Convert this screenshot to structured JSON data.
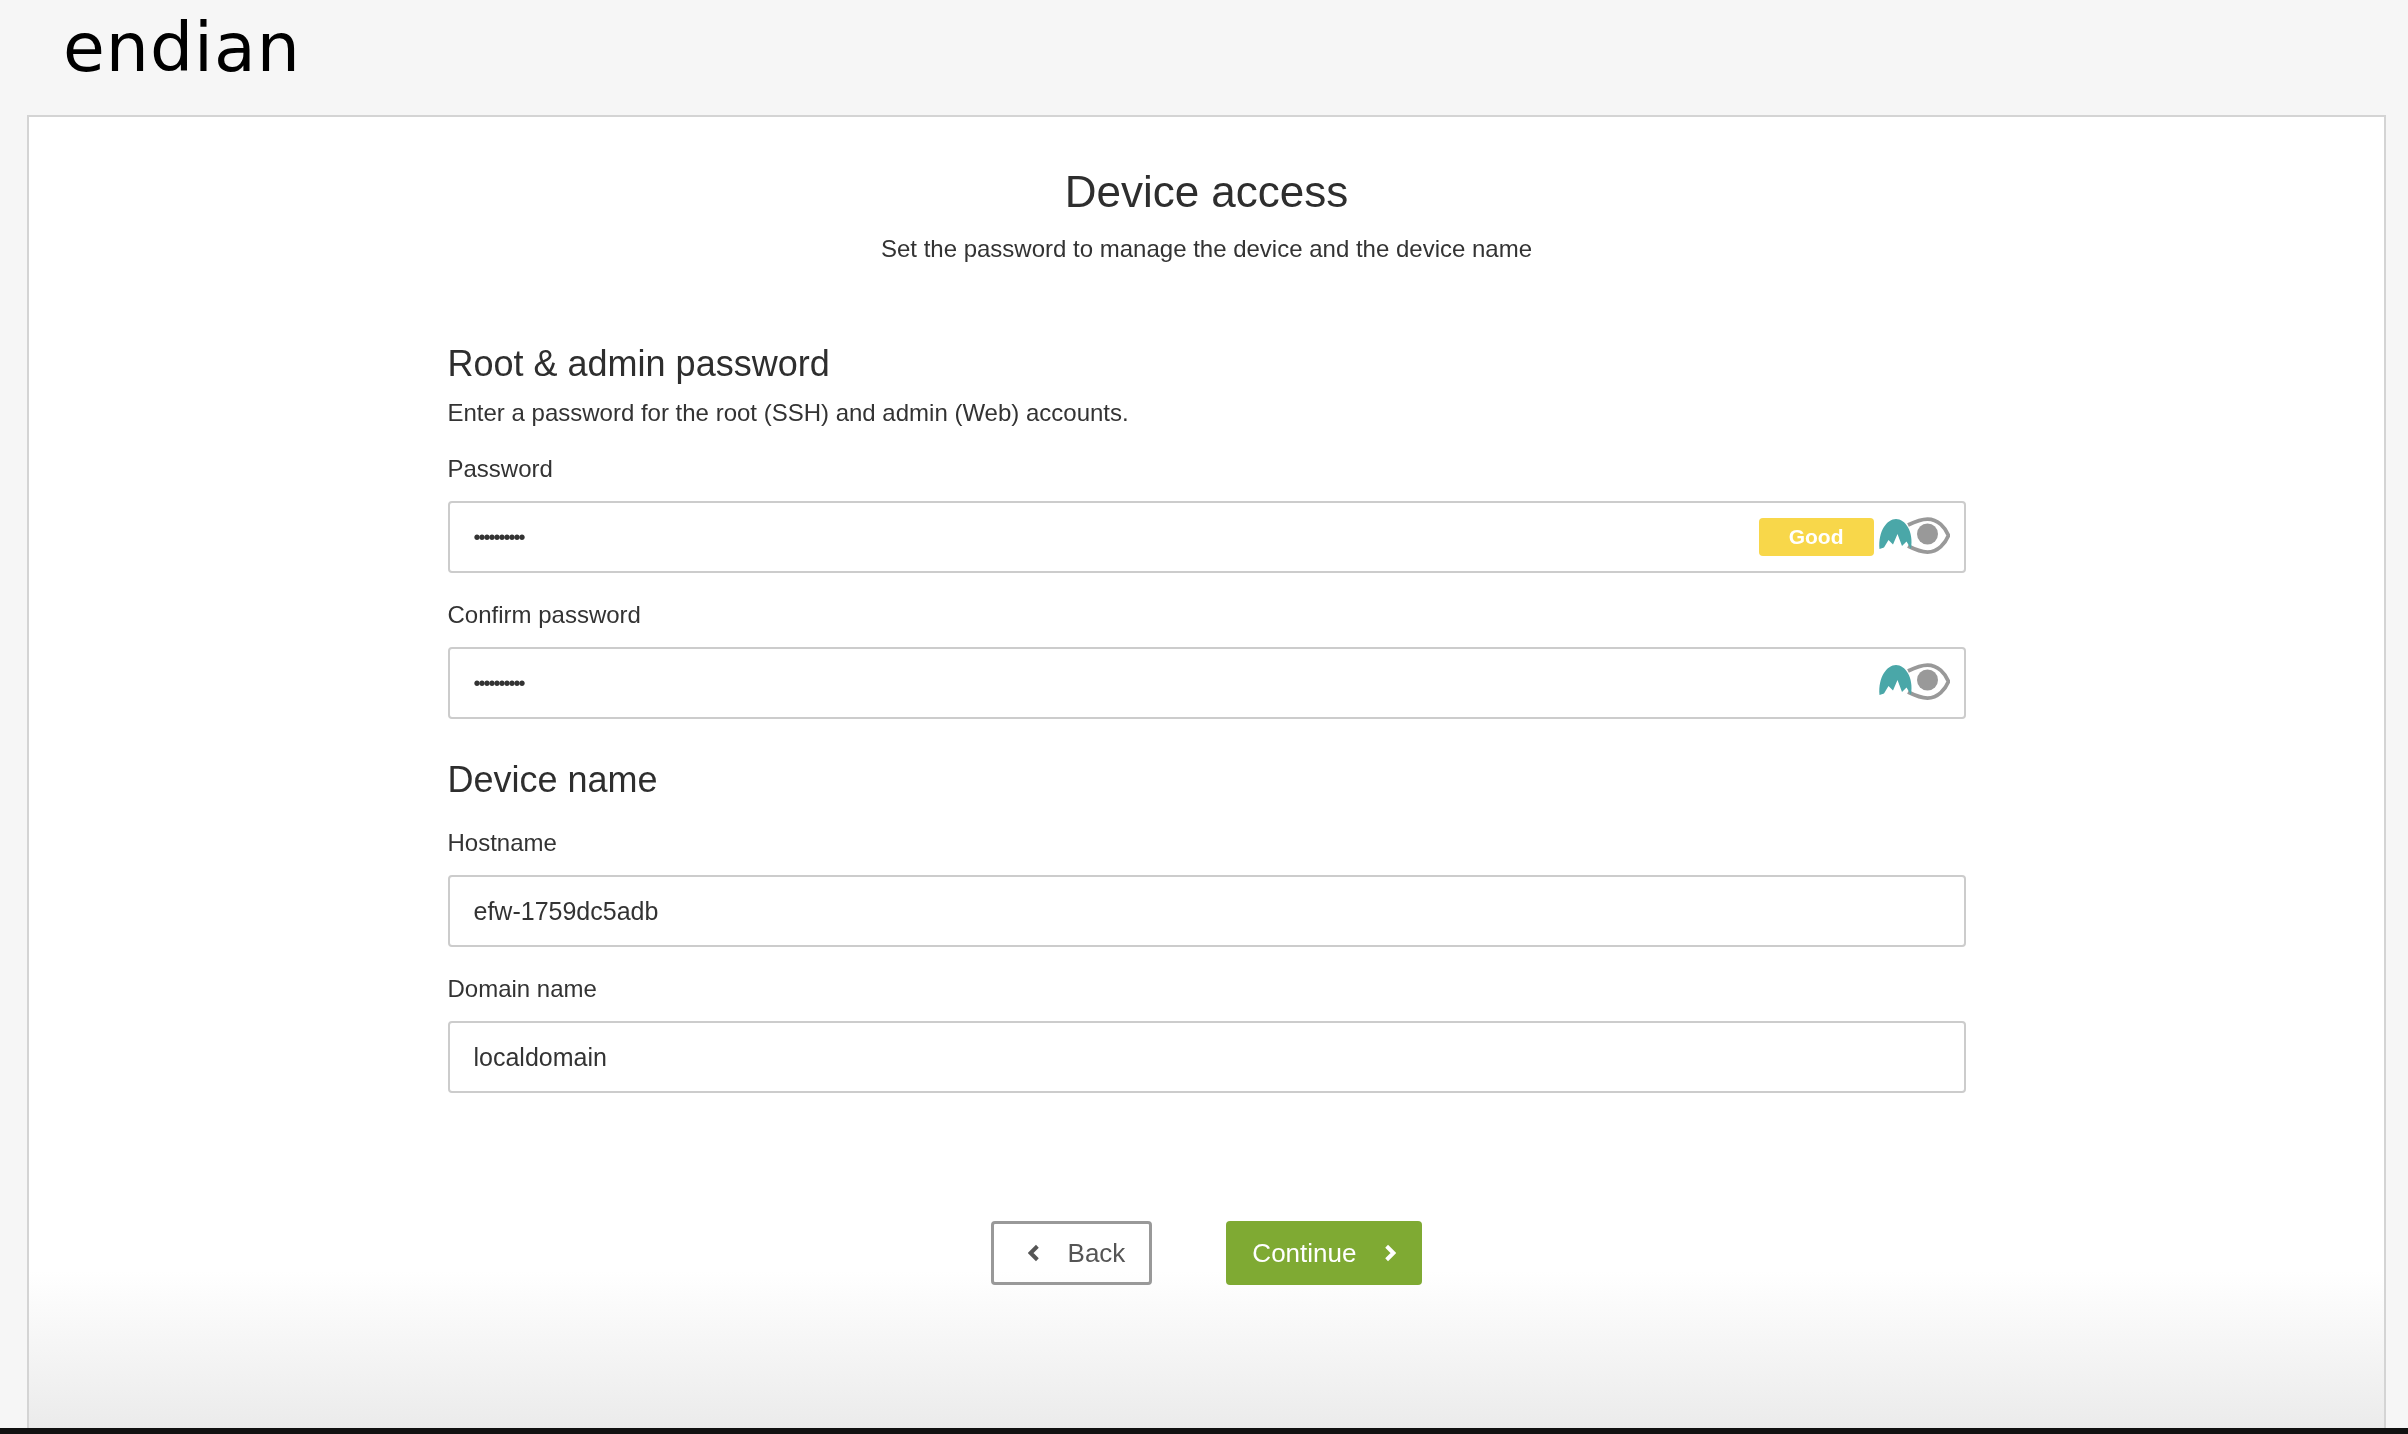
{
  "logo": {
    "text": "endian"
  },
  "page": {
    "title": "Device access",
    "subtitle": "Set the password to manage the device and the device name"
  },
  "sections": [
    {
      "title": "Root & admin password",
      "description": "Enter a password for the root (SSH) and admin (Web) accounts.",
      "fields": [
        {
          "kind": "password",
          "label": "Password",
          "value": "••••••••••",
          "strength": "Good"
        },
        {
          "kind": "password",
          "label": "Confirm password",
          "value": "••••••••••"
        }
      ]
    },
    {
      "title": "Device name",
      "fields": [
        {
          "kind": "text",
          "label": "Hostname",
          "value": "efw-1759dc5adb"
        },
        {
          "kind": "text",
          "label": "Domain name",
          "value": "localdomain"
        }
      ]
    }
  ],
  "buttons": [
    {
      "kind": "back",
      "label": "Back"
    },
    {
      "kind": "continue",
      "label": "Continue"
    }
  ]
}
